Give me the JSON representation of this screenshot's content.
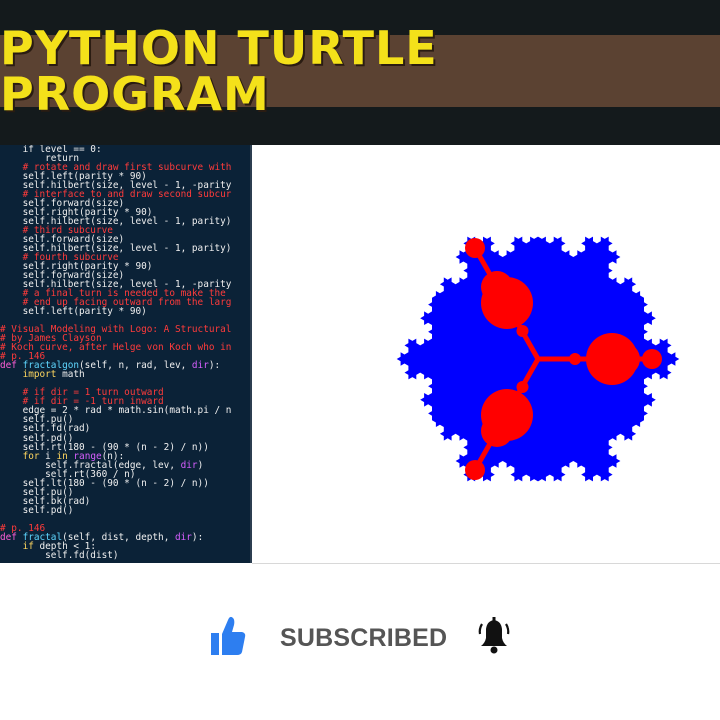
{
  "banner": {
    "title": "PYTHON TURTLE PROGRAM"
  },
  "editor": {
    "lines": [
      [
        {
          "t": "    if level == 0:",
          "c": ""
        }
      ],
      [
        {
          "t": "        return",
          "c": ""
        }
      ],
      [
        {
          "t": "    # rotate and draw first subcurve with",
          "c": "cmt"
        }
      ],
      [
        {
          "t": "    self.left(parity * 90)",
          "c": ""
        }
      ],
      [
        {
          "t": "    self.hilbert(size, level - 1, -parity",
          "c": ""
        }
      ],
      [
        {
          "t": "    # interface to and draw second subcur",
          "c": "cmt"
        }
      ],
      [
        {
          "t": "    self.forward(size)",
          "c": ""
        }
      ],
      [
        {
          "t": "    self.right(parity * 90)",
          "c": ""
        }
      ],
      [
        {
          "t": "    self.hilbert(size, level - 1, parity)",
          "c": ""
        }
      ],
      [
        {
          "t": "    # third subcurve",
          "c": "cmt"
        }
      ],
      [
        {
          "t": "    self.forward(size)",
          "c": ""
        }
      ],
      [
        {
          "t": "    self.hilbert(size, level - 1, parity)",
          "c": ""
        }
      ],
      [
        {
          "t": "    # fourth subcurve",
          "c": "cmt"
        }
      ],
      [
        {
          "t": "    self.right(parity * 90)",
          "c": ""
        }
      ],
      [
        {
          "t": "    self.forward(size)",
          "c": ""
        }
      ],
      [
        {
          "t": "    self.hilbert(size, level - 1, -parity",
          "c": ""
        }
      ],
      [
        {
          "t": "    # a final turn is needed to make the",
          "c": "cmt"
        }
      ],
      [
        {
          "t": "    # end up facing outward from the larg",
          "c": "cmt"
        }
      ],
      [
        {
          "t": "    self.left(parity * 90)",
          "c": ""
        }
      ],
      [
        {
          "t": "",
          "c": ""
        }
      ],
      [
        {
          "t": "# Visual Modeling with Logo: A Structural",
          "c": "cmt"
        }
      ],
      [
        {
          "t": "# by James Clayson",
          "c": "cmt"
        }
      ],
      [
        {
          "t": "# Koch curve, after Helge von Koch who in",
          "c": "cmt"
        }
      ],
      [
        {
          "t": "# p. 146",
          "c": "cmt"
        }
      ],
      [
        {
          "t": "def ",
          "c": "def"
        },
        {
          "t": "fractalgon",
          "c": "fn"
        },
        {
          "t": "(self, n, rad, lev, ",
          "c": ""
        },
        {
          "t": "dir",
          "c": "par"
        },
        {
          "t": "):",
          "c": ""
        }
      ],
      [
        {
          "t": "    import",
          "c": "kw"
        },
        {
          "t": " math",
          "c": ""
        }
      ],
      [
        {
          "t": "",
          "c": ""
        }
      ],
      [
        {
          "t": "    # if dir = 1 turn outward",
          "c": "cmt"
        }
      ],
      [
        {
          "t": "    # if dir = -1 turn inward",
          "c": "cmt"
        }
      ],
      [
        {
          "t": "    edge = 2 * rad * math.sin(math.pi / n",
          "c": ""
        }
      ],
      [
        {
          "t": "    self.pu()",
          "c": ""
        }
      ],
      [
        {
          "t": "    self.fd(rad)",
          "c": ""
        }
      ],
      [
        {
          "t": "    self.pd()",
          "c": ""
        }
      ],
      [
        {
          "t": "    self.rt(180 - (90 * (n - 2) / n))",
          "c": ""
        }
      ],
      [
        {
          "t": "    for",
          "c": "kw"
        },
        {
          "t": " i ",
          "c": ""
        },
        {
          "t": "in",
          "c": "kw"
        },
        {
          "t": " ",
          "c": ""
        },
        {
          "t": "range",
          "c": "par"
        },
        {
          "t": "(n):",
          "c": ""
        }
      ],
      [
        {
          "t": "        self.fractal(edge, lev, ",
          "c": ""
        },
        {
          "t": "dir",
          "c": "par"
        },
        {
          "t": ")",
          "c": ""
        }
      ],
      [
        {
          "t": "        self.rt(360 / n)",
          "c": ""
        }
      ],
      [
        {
          "t": "    self.lt(180 - (90 * (n - 2) / n))",
          "c": ""
        }
      ],
      [
        {
          "t": "    self.pu()",
          "c": ""
        }
      ],
      [
        {
          "t": "    self.bk(rad)",
          "c": ""
        }
      ],
      [
        {
          "t": "    self.pd()",
          "c": ""
        }
      ],
      [
        {
          "t": "",
          "c": ""
        }
      ],
      [
        {
          "t": "# p. 146",
          "c": "cmt"
        }
      ],
      [
        {
          "t": "def ",
          "c": "def"
        },
        {
          "t": "fractal",
          "c": "fn"
        },
        {
          "t": "(self, dist, depth, ",
          "c": ""
        },
        {
          "t": "dir",
          "c": "par"
        },
        {
          "t": "):",
          "c": ""
        }
      ],
      [
        {
          "t": "    if",
          "c": "kw"
        },
        {
          "t": " depth < 1:",
          "c": ""
        }
      ],
      [
        {
          "t": "        self.fd(dist)",
          "c": ""
        }
      ]
    ]
  },
  "canvas": {
    "fractal_fill": "#0000ff",
    "branch_color": "#ff0000"
  },
  "subscribe": {
    "label": "SUBSCRIBED",
    "like_icon": "thumbs-up-icon",
    "bell_icon": "bell-ringing-icon",
    "like_color": "#2d7ef0"
  }
}
